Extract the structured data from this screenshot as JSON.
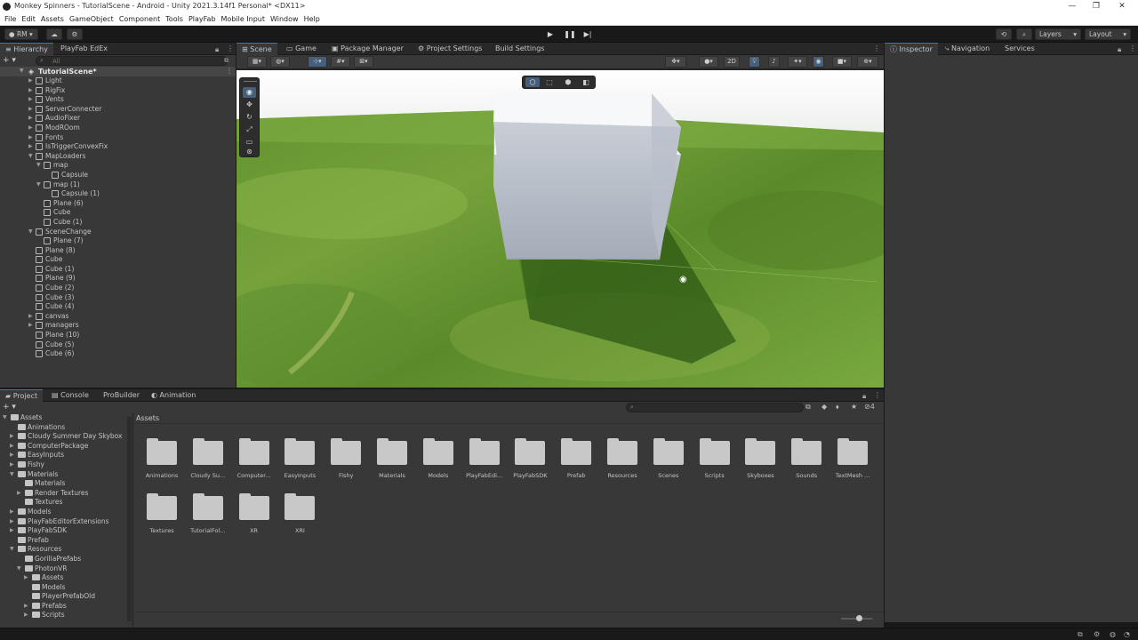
{
  "window": {
    "title": "Monkey Spinners - TutorialScene - Android - Unity 2021.3.14f1 Personal* <DX11>",
    "minimize": "—",
    "maximize": "❐",
    "close": "✕"
  },
  "menu": [
    "File",
    "Edit",
    "Assets",
    "GameObject",
    "Component",
    "Tools",
    "PlayFab",
    "Mobile Input",
    "Window",
    "Help"
  ],
  "toolbar": {
    "account": "RM",
    "layers": "Layers",
    "layout": "Layout"
  },
  "hierarchy": {
    "tabs": [
      "Hierarchy",
      "PlayFab EdEx"
    ],
    "search_placeholder": "All",
    "scene": "TutorialScene*",
    "items": [
      {
        "label": "Light",
        "indent": 1,
        "expand": "closed"
      },
      {
        "label": "RigFix",
        "indent": 1,
        "expand": "closed"
      },
      {
        "label": "Vents",
        "indent": 1,
        "expand": "closed"
      },
      {
        "label": "ServerConnecter",
        "indent": 1,
        "expand": "closed"
      },
      {
        "label": "AudioFixer",
        "indent": 1,
        "expand": "closed"
      },
      {
        "label": "ModROom",
        "indent": 1,
        "expand": "closed"
      },
      {
        "label": "Fonts",
        "indent": 1,
        "expand": "closed"
      },
      {
        "label": "IsTriggerConvexFix",
        "indent": 1,
        "expand": "closed"
      },
      {
        "label": "MapLoaders",
        "indent": 1,
        "expand": "open"
      },
      {
        "label": "map",
        "indent": 2,
        "expand": "open"
      },
      {
        "label": "Capsule",
        "indent": 3,
        "expand": "none"
      },
      {
        "label": "map (1)",
        "indent": 2,
        "expand": "open"
      },
      {
        "label": "Capsule (1)",
        "indent": 3,
        "expand": "none"
      },
      {
        "label": "Plane (6)",
        "indent": 2,
        "expand": "none"
      },
      {
        "label": "Cube",
        "indent": 2,
        "expand": "none"
      },
      {
        "label": "Cube (1)",
        "indent": 2,
        "expand": "none"
      },
      {
        "label": "SceneChange",
        "indent": 1,
        "expand": "open"
      },
      {
        "label": "Plane (7)",
        "indent": 2,
        "expand": "none"
      },
      {
        "label": "Plane (8)",
        "indent": 1,
        "expand": "none"
      },
      {
        "label": "Cube",
        "indent": 1,
        "expand": "none"
      },
      {
        "label": "Cube (1)",
        "indent": 1,
        "expand": "none"
      },
      {
        "label": "Plane (9)",
        "indent": 1,
        "expand": "none"
      },
      {
        "label": "Cube (2)",
        "indent": 1,
        "expand": "none"
      },
      {
        "label": "Cube (3)",
        "indent": 1,
        "expand": "none"
      },
      {
        "label": "Cube (4)",
        "indent": 1,
        "expand": "none"
      },
      {
        "label": "canvas",
        "indent": 1,
        "expand": "closed"
      },
      {
        "label": "managers",
        "indent": 1,
        "expand": "closed"
      },
      {
        "label": "Plane (10)",
        "indent": 1,
        "expand": "none"
      },
      {
        "label": "Cube (5)",
        "indent": 1,
        "expand": "none"
      },
      {
        "label": "Cube (6)",
        "indent": 1,
        "expand": "none"
      }
    ]
  },
  "scene_tabs": [
    "Scene",
    "Game",
    "Package Manager",
    "Project Settings",
    "Build Settings"
  ],
  "scene_view": {
    "mode_2d": "2D"
  },
  "inspector": {
    "tabs": [
      "Inspector",
      "Navigation",
      "Services"
    ]
  },
  "bottom_tabs": [
    "Project",
    "Console",
    "ProBuilder",
    "Animation"
  ],
  "project": {
    "breadcrumb": "Assets",
    "count": "4",
    "tree": [
      {
        "label": "Assets",
        "indent": 0,
        "expand": "open"
      },
      {
        "label": "Animations",
        "indent": 1,
        "expand": "none"
      },
      {
        "label": "Cloudy Summer Day Skybox",
        "indent": 1,
        "expand": "closed"
      },
      {
        "label": "ComputerPackage",
        "indent": 1,
        "expand": "closed"
      },
      {
        "label": "EasyInputs",
        "indent": 1,
        "expand": "closed"
      },
      {
        "label": "Fishy",
        "indent": 1,
        "expand": "closed"
      },
      {
        "label": "Materials",
        "indent": 1,
        "expand": "open"
      },
      {
        "label": "Materials",
        "indent": 2,
        "expand": "none"
      },
      {
        "label": "Render Textures",
        "indent": 2,
        "expand": "closed"
      },
      {
        "label": "Textures",
        "indent": 2,
        "expand": "none"
      },
      {
        "label": "Models",
        "indent": 1,
        "expand": "closed"
      },
      {
        "label": "PlayFabEditorExtensions",
        "indent": 1,
        "expand": "closed"
      },
      {
        "label": "PlayFabSDK",
        "indent": 1,
        "expand": "closed"
      },
      {
        "label": "Prefab",
        "indent": 1,
        "expand": "none"
      },
      {
        "label": "Resources",
        "indent": 1,
        "expand": "open"
      },
      {
        "label": "GorillaPrefabs",
        "indent": 2,
        "expand": "none"
      },
      {
        "label": "PhotonVR",
        "indent": 2,
        "expand": "open"
      },
      {
        "label": "Assets",
        "indent": 3,
        "expand": "closed"
      },
      {
        "label": "Models",
        "indent": 3,
        "expand": "none"
      },
      {
        "label": "PlayerPrefabOld",
        "indent": 3,
        "expand": "none"
      },
      {
        "label": "Prefabs",
        "indent": 3,
        "expand": "closed"
      },
      {
        "label": "Scripts",
        "indent": 3,
        "expand": "closed"
      }
    ],
    "folders": [
      "Animations",
      "Cloudy Su...",
      "Computer...",
      "EasyInputs",
      "Fishy",
      "Materials",
      "Models",
      "PlayFabEdi...",
      "PlayFabSDK",
      "Prefab",
      "Resources",
      "Scenes",
      "Scripts",
      "Skyboxes",
      "Sounds",
      "TextMesh ...",
      "Textures",
      "TutorialFol...",
      "XR",
      "XRI"
    ]
  }
}
